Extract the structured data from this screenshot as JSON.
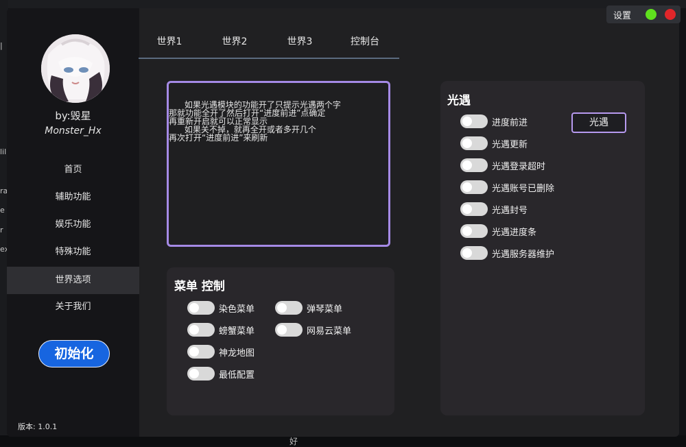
{
  "background": {
    "left_fragments": [
      "|",
      "lili",
      "ra",
      "e",
      "r",
      "ex"
    ],
    "bottom_fragment": "好"
  },
  "sidebar": {
    "author_line1": "by:毁星",
    "author_line2": "Monster_Hx",
    "nav": [
      {
        "label": "首页",
        "active": false
      },
      {
        "label": "辅助功能",
        "active": false
      },
      {
        "label": "娱乐功能",
        "active": false
      },
      {
        "label": "特殊功能",
        "active": false
      },
      {
        "label": "世界选项",
        "active": true
      },
      {
        "label": "关于我们",
        "active": false
      }
    ],
    "init_label": "初始化",
    "version": "版本: 1.0.1"
  },
  "tabs": [
    "世界1",
    "世界2",
    "世界3",
    "控制台"
  ],
  "info": {
    "lines": [
      "      如果光遇模块的功能开了只提示光遇两个字",
      "那就功能全开了然后打开“进度前进”点确定",
      "再重新开启就可以正常显示",
      "      如果关不掉，就再全开或者多开几个",
      "再次打开“进度前进”来刷新"
    ]
  },
  "menu_panel": {
    "title": "菜单 控制",
    "col1": [
      "染色菜单",
      "螃蟹菜单",
      "神龙地图",
      "最低配置"
    ],
    "col2": [
      "弹琴菜单",
      "网易云菜单"
    ]
  },
  "sky_panel": {
    "title": "光遇",
    "button_label": "光遇",
    "toggles": [
      "进度前进",
      "光遇更新",
      "光遇登录超时",
      "光遇账号已删除",
      "光遇封号",
      "光遇进度条",
      "光遇服务器维护"
    ]
  },
  "top_controls": {
    "settings_label": "设置",
    "colors": {
      "green": "#5fe01e",
      "red": "#e0262a"
    }
  }
}
